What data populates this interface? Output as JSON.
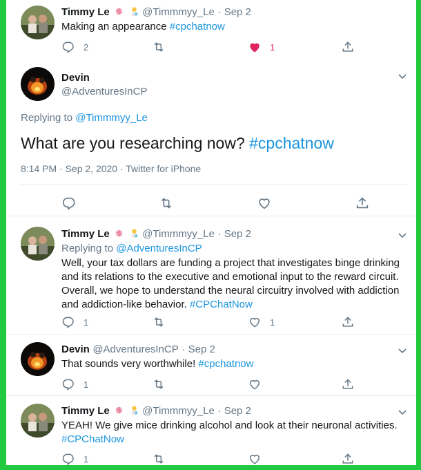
{
  "tweets": [
    {
      "name": "Timmy Le",
      "handle": "@Timmmyy_Le",
      "dot": "·",
      "date": "Sep 2",
      "text": "Making an appearance ",
      "tag": "#cpchatnow",
      "replies": "2",
      "likes": "1"
    },
    {
      "name": "Devin",
      "handle": "@AdventuresInCP",
      "replying_prefix": "Replying to ",
      "replying_to": "@Timmmyy_Le",
      "text": "What are you researching now? ",
      "tag": "#cpchatnow",
      "timestamp": "8:14 PM · Sep 2, 2020 · Twitter for iPhone"
    },
    {
      "name": "Timmy Le",
      "handle": "@Timmmyy_Le",
      "dot": "·",
      "date": "Sep 2",
      "replying_prefix": "Replying to ",
      "replying_to": "@AdventuresInCP",
      "lines": [
        "Well, your tax dollars are funding a project that investigates binge drinking",
        "and its relations to the executive and emotional input to the reward circuit.",
        "Overall, we hope to understand the neural circuitry involved with addiction",
        "and addiction-like behavior. "
      ],
      "tag": "#CPChatNow",
      "replies": "1",
      "likes": "1"
    },
    {
      "name": "Devin",
      "handle": "@AdventuresInCP",
      "dot": "·",
      "date": "Sep 2",
      "text": "That sounds very worthwhile! ",
      "tag": "#cpchatnow",
      "replies": "1"
    },
    {
      "name": "Timmy Le",
      "handle": "@Timmmyy_Le",
      "dot": "·",
      "date": "Sep 2",
      "text": "YEAH! We give mice drinking alcohol and look at their neuronal activities.",
      "tag": "#CPChatNow",
      "replies": "1"
    }
  ],
  "colors": {
    "background": "#22c93f",
    "link": "#1b95e0",
    "muted": "#657786",
    "like_active": "#e0245e",
    "divider": "#e6ecf0"
  },
  "icons": [
    "reply-icon",
    "retweet-icon",
    "like-icon",
    "share-icon",
    "caret-down-icon",
    "brain-emoji-icon",
    "scientist-emoji-icon"
  ]
}
